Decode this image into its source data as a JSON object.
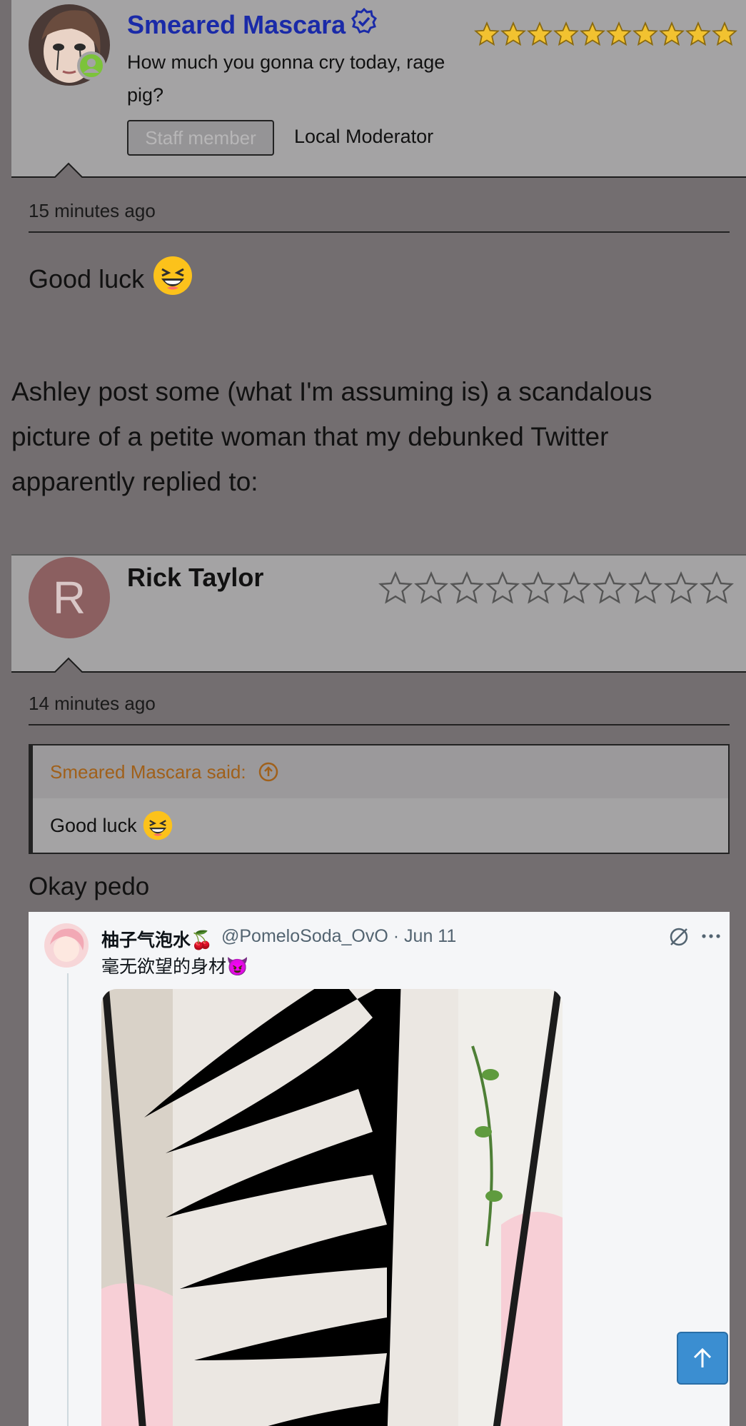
{
  "post1": {
    "author": "Smeared Mascara",
    "user_title": "How much you gonna cry today, rage pig?",
    "badge": "Staff member",
    "role": "Local Moderator",
    "rating_stars": 10,
    "rating_filled": 10,
    "time": "15 minutes ago",
    "body": "Good luck"
  },
  "article": {
    "text": "Ashley post some (what I'm assuming is) a scandalous picture of a petite woman that my debunked Twitter apparently replied to:"
  },
  "post2": {
    "author": "Rick Taylor",
    "avatar_letter": "R",
    "rating_stars": 10,
    "rating_filled": 0,
    "time": "14 minutes ago",
    "quote_author": "Smeared Mascara said:",
    "quote_text": "Good luck",
    "body": "Okay pedo"
  },
  "tweet": {
    "display_name": "柚子气泡水🍒",
    "handle_date": "@PomeloSoda_OvO · Jun 11",
    "text": "毫无欲望的身材😈"
  },
  "colors": {
    "page_bg": "#736e70",
    "card_bg": "#a4a3a4",
    "username_blue": "#1a2aa8",
    "star_gold": "#f2c230",
    "quote_orange": "#a0601a",
    "button_blue": "#3b8ed1"
  },
  "icons": [
    "verified-icon",
    "star-icon",
    "user-online-icon",
    "arrow-up-circle-icon",
    "retweet-icon",
    "more-icon",
    "arrow-up-icon",
    "laughing-emoji-icon"
  ]
}
